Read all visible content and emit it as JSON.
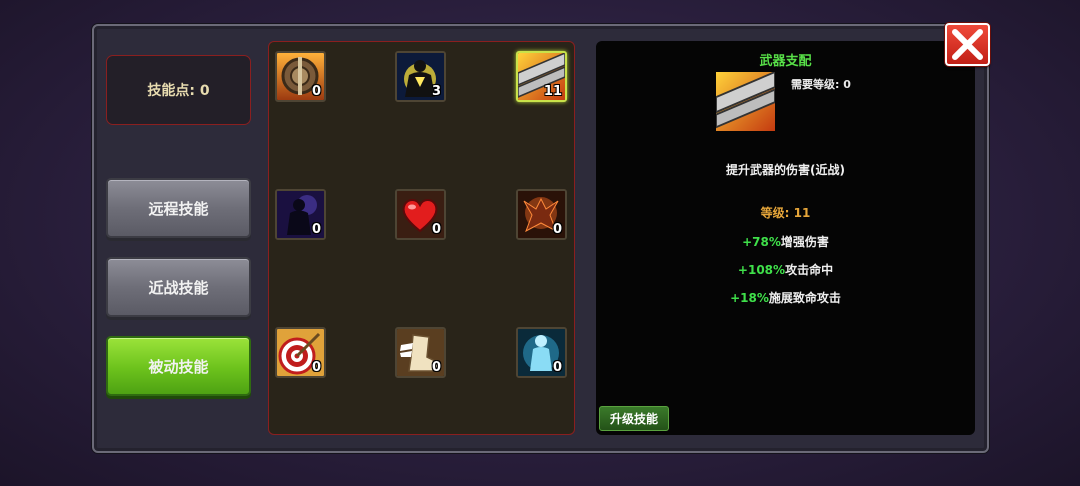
{
  "skill_points": {
    "label": "技能点: 0"
  },
  "categories": [
    {
      "label": "远程技能",
      "state": "inactive"
    },
    {
      "label": "近战技能",
      "state": "inactive"
    },
    {
      "label": "被动技能",
      "state": "active"
    }
  ],
  "skills": [
    {
      "icon": "shield-icon",
      "level": "0"
    },
    {
      "icon": "glowing-figure-icon",
      "level": "3"
    },
    {
      "icon": "weapon-mastery-blade-icon",
      "level": "11",
      "selected": true
    },
    {
      "icon": "shadow-figure-icon",
      "level": "0"
    },
    {
      "icon": "heart-icon",
      "level": "0"
    },
    {
      "icon": "fiery-demon-icon",
      "level": "0"
    },
    {
      "icon": "target-arrow-icon",
      "level": "0"
    },
    {
      "icon": "winged-boot-icon",
      "level": "0"
    },
    {
      "icon": "blue-aura-figure-icon",
      "level": "0"
    }
  ],
  "detail": {
    "title": "武器支配",
    "requirement": "需要等级: 0",
    "description": "提升武器的伤害(近战)",
    "level": "等级: 11",
    "stats": [
      {
        "pct": "+78%",
        "text": "增强伤害"
      },
      {
        "pct": "+108%",
        "text": "攻击命中"
      },
      {
        "pct": "+18%",
        "text": "施展致命攻击"
      }
    ],
    "upgrade_label": "升级技能"
  },
  "colors": {
    "accent_green": "#58e048",
    "level_orange": "#e6a63a",
    "panel_border_red": "#8a1f1f",
    "close_red": "#d9271d"
  }
}
